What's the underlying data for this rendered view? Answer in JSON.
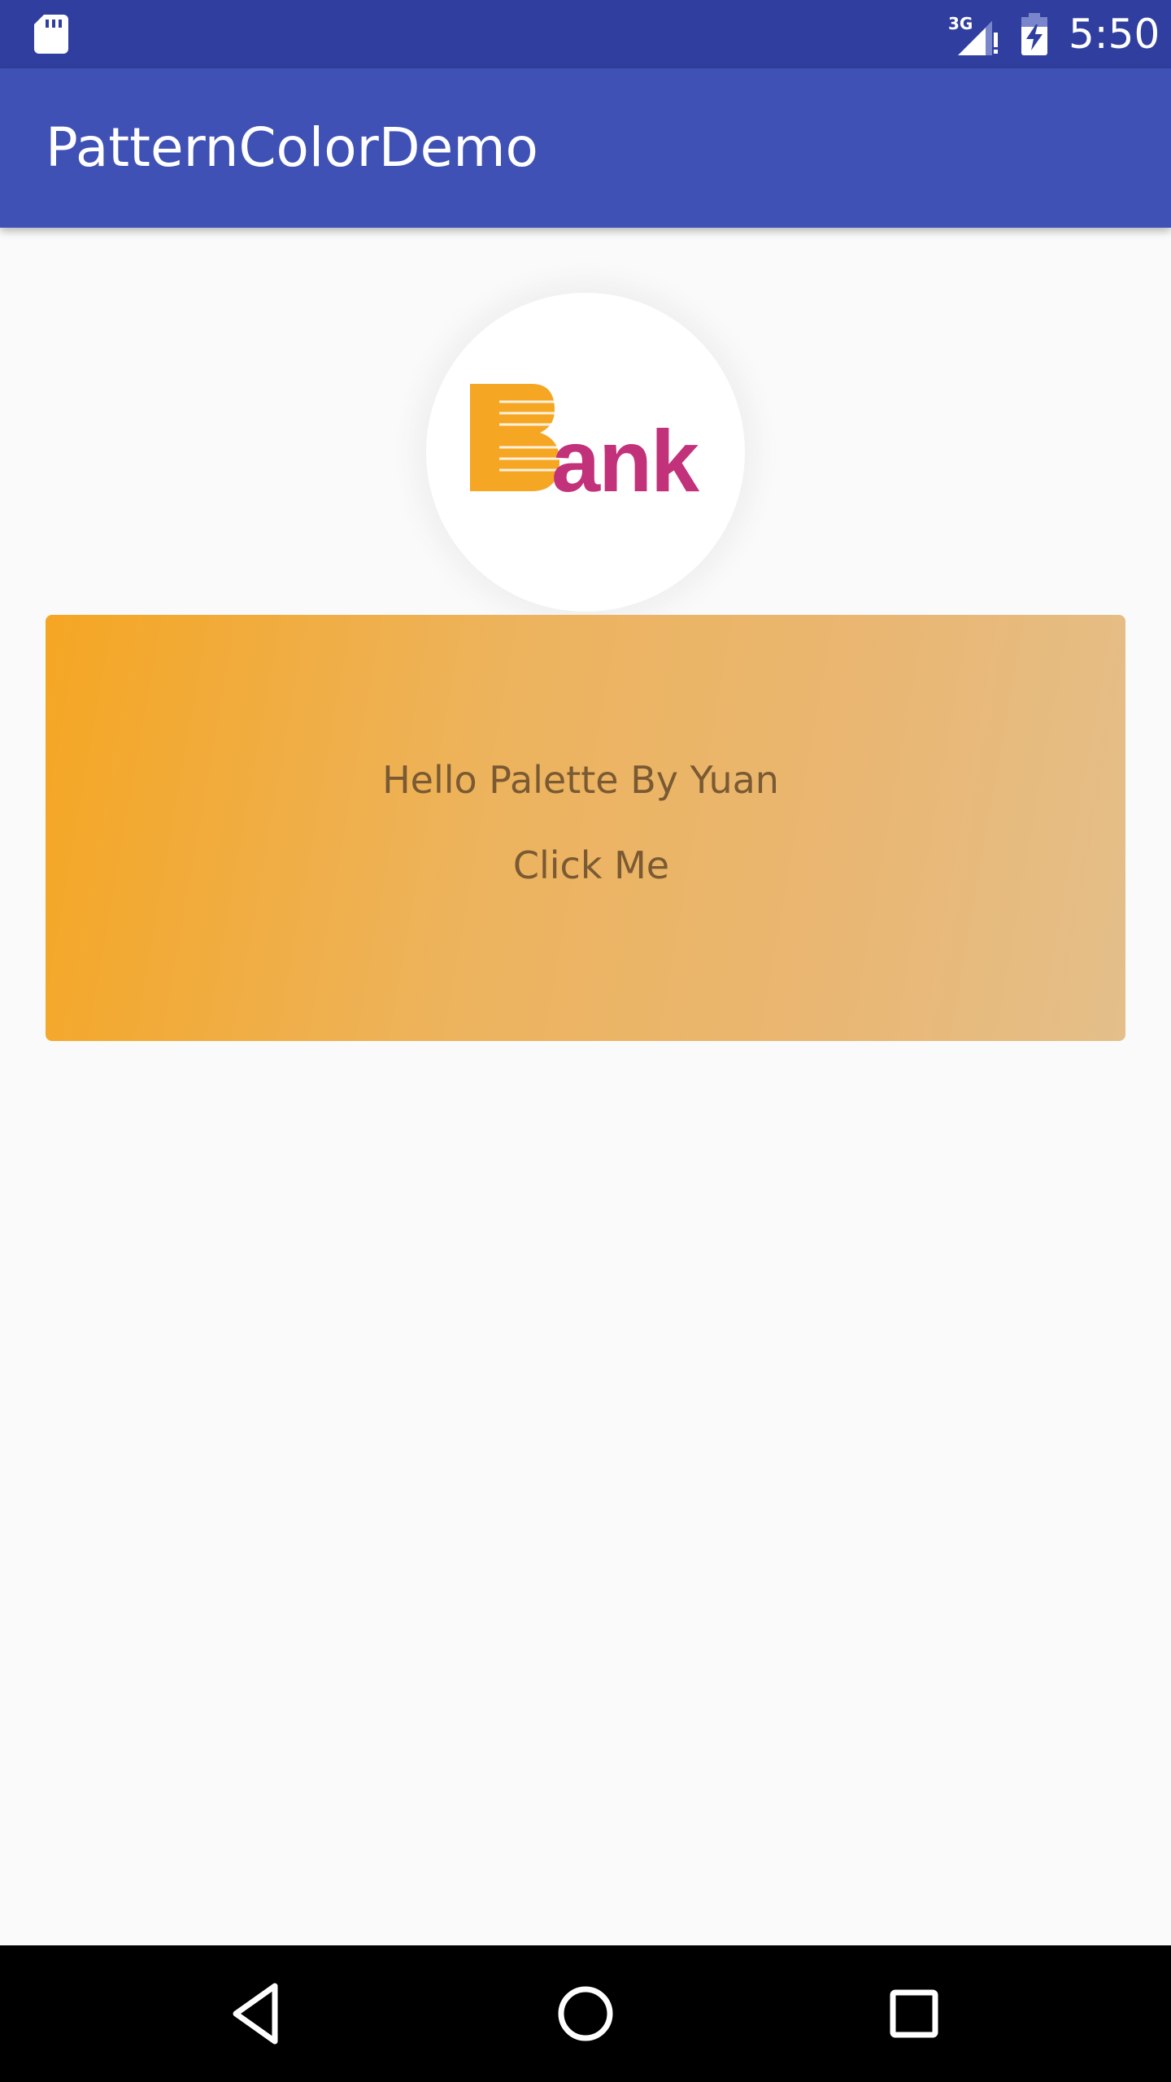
{
  "status_bar": {
    "time": "5:50",
    "network": "3G",
    "icons": [
      "sd-card-icon",
      "signal-3g-icon",
      "battery-charging-icon"
    ]
  },
  "app_bar": {
    "title": "PatternColorDemo"
  },
  "logo": {
    "text": "Bank",
    "colors": {
      "letter_b": "#f5a623",
      "letters_ank": "#c2327a"
    }
  },
  "card": {
    "text": "Hello Palette By Yuan",
    "button_label": "Click Me",
    "gradient": [
      "#f5a623",
      "#e4bf8a"
    ],
    "text_color": "#7a5a33"
  },
  "nav_bar": {
    "icons": [
      "back-icon",
      "home-icon",
      "recent-apps-icon"
    ]
  },
  "colors": {
    "status_bar": "#303f9f",
    "app_bar": "#3f51b5",
    "background": "#fafafa"
  }
}
